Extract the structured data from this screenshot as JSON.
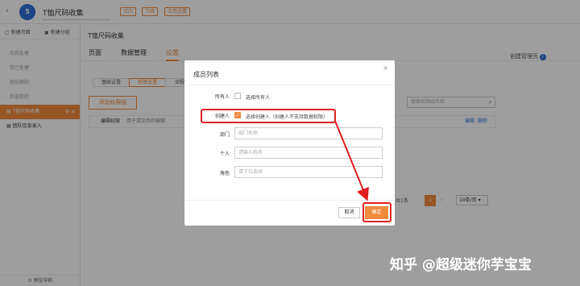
{
  "topbar": {
    "back_icon": "‹",
    "logo_text": "5",
    "app_name": "T恤尺码收集",
    "tags": [
      "访问",
      "下线",
      "应用设置"
    ]
  },
  "sidebar": {
    "new_page": "新建页面",
    "new_group": "新建分组",
    "items": [
      {
        "label": "待我处理"
      },
      {
        "label": "我已处理"
      },
      {
        "label": "我创建的"
      },
      {
        "label": "抄送我的"
      },
      {
        "label": "T恤尺码收集"
      },
      {
        "label": "团队信息录入"
      }
    ],
    "footer": "预览导航"
  },
  "main": {
    "page_title": "T恤尺码收集",
    "tabs": [
      "页面",
      "数据管理",
      "设置"
    ],
    "creator_label": "创建管理页",
    "subtabs": [
      "基础设置",
      "权限设置",
      "流程"
    ],
    "add_group": "添加权限组",
    "search_placeholder": "搜索权限组名称",
    "row": {
      "label": "编辑权限",
      "desc": "用于提交后的编辑",
      "edit": "编辑",
      "delete": "删除"
    },
    "pager": {
      "total": "共1条",
      "page": "1",
      "next": "›",
      "size": "10条/页"
    }
  },
  "modal": {
    "title": "成员列表",
    "close": "×",
    "all_label": "所有人",
    "all_option": "选择所有人",
    "creator_label": "创建人",
    "creator_option": "选择创建人（创建人不支持数据权限）",
    "dept_label": "部门",
    "dept_placeholder": "部门名称",
    "person_label": "个人",
    "person_placeholder": "请输入姓名",
    "role_label": "角色",
    "role_placeholder": "请下拉选择",
    "cancel": "取消",
    "confirm": "确定"
  },
  "watermark": "知乎 @超级迷你芋宝宝",
  "colors": {
    "accent": "#f08a3c",
    "highlight": "#e02020",
    "brand": "#2f6fd6"
  }
}
